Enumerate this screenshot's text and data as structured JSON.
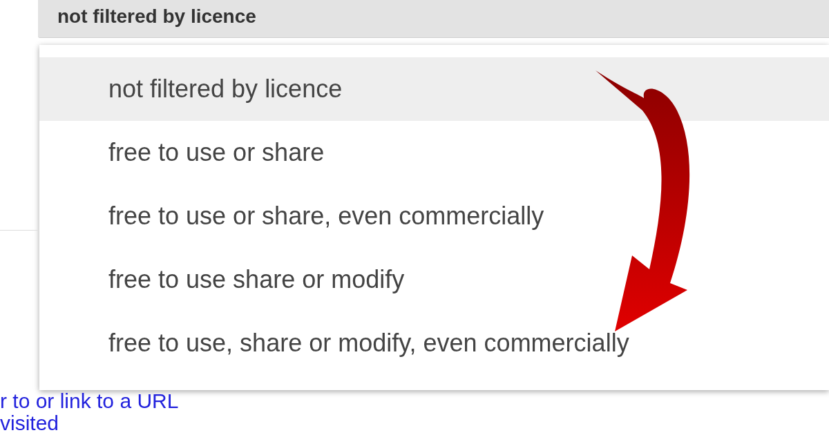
{
  "licence_select": {
    "value": "not filtered by licence"
  },
  "menu": {
    "options": [
      {
        "label": "not filtered by licence",
        "selected": true
      },
      {
        "label": "free to use or share",
        "selected": false
      },
      {
        "label": "free to use or share, even commercially",
        "selected": false
      },
      {
        "label": "free to use share or modify",
        "selected": false
      },
      {
        "label": "free to use, share or modify, even commercially",
        "selected": false
      }
    ]
  },
  "links": [
    "r to or link to a URL",
    "visited"
  ]
}
